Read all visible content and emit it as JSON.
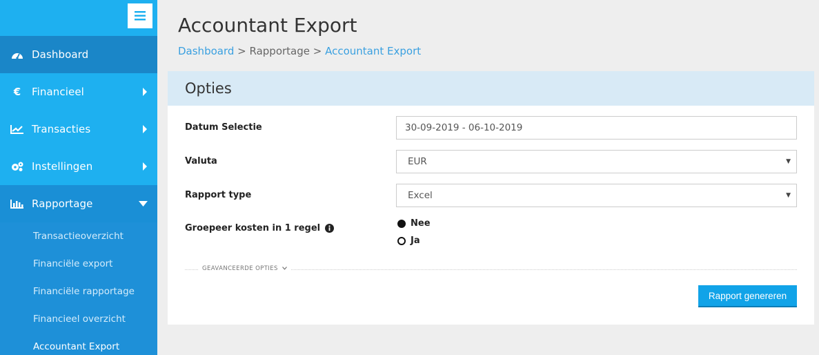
{
  "page": {
    "title": "Accountant Export",
    "breadcrumb": {
      "home": "Dashboard",
      "sep1": " > ",
      "section": "Rapportage",
      "sep2": " > ",
      "current": "Accountant Export"
    }
  },
  "sidebar": {
    "items": [
      {
        "label": "Dashboard",
        "icon": "dashboard-icon"
      },
      {
        "label": "Financieel",
        "icon": "euro-icon"
      },
      {
        "label": "Transacties",
        "icon": "line-chart-icon"
      },
      {
        "label": "Instellingen",
        "icon": "gears-icon"
      },
      {
        "label": "Rapportage",
        "icon": "bar-chart-icon"
      }
    ],
    "euro_glyph": "€",
    "submenu": [
      {
        "label": "Transactieoverzicht"
      },
      {
        "label": "Financiële export"
      },
      {
        "label": "Financiële rapportage"
      },
      {
        "label": "Financieel overzicht"
      },
      {
        "label": "Accountant Export"
      }
    ]
  },
  "panel": {
    "heading": "Opties",
    "fields": {
      "date_label": "Datum Selectie",
      "date_value": "30-09-2019 - 06-10-2019",
      "currency_label": "Valuta",
      "currency_value": "EUR",
      "type_label": "Rapport type",
      "type_value": "Excel",
      "group_label": "Groepeer kosten in 1 regel",
      "group_options": [
        "Nee",
        "Ja"
      ],
      "group_selected": "Nee"
    },
    "advanced_label": "GEAVANCEERDE OPTIES",
    "generate_button": "Rapport genereren"
  },
  "colors": {
    "sidebar": "#1e90d8",
    "sidebar_light": "#1eb0f0",
    "panel_header": "#d8eaf6",
    "accent": "#11a3e8",
    "link": "#3aa0e0"
  }
}
